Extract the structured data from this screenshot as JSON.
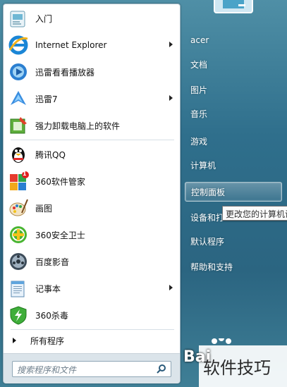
{
  "left_panel": {
    "items": [
      {
        "label": "入门",
        "icon": "getting-started-icon",
        "submenu": false
      },
      {
        "label": "Internet Explorer",
        "icon": "internet-explorer-icon",
        "submenu": true
      },
      {
        "label": "迅雷看看播放器",
        "icon": "xunlei-kankan-player-icon",
        "submenu": false
      },
      {
        "label": "迅雷7",
        "icon": "xunlei7-icon",
        "submenu": true
      },
      {
        "label": "强力卸载电脑上的软件",
        "icon": "uninstaller-icon",
        "submenu": false
      },
      {
        "label": "腾讯QQ",
        "icon": "qq-penguin-icon",
        "submenu": false
      },
      {
        "label": "360软件管家",
        "icon": "360-software-manager-icon",
        "submenu": false
      },
      {
        "label": "画图",
        "icon": "paint-palette-icon",
        "submenu": false
      },
      {
        "label": "360安全卫士",
        "icon": "360-security-guard-icon",
        "submenu": false
      },
      {
        "label": "百度影音",
        "icon": "baidu-player-icon",
        "submenu": false
      },
      {
        "label": "记事本",
        "icon": "notepad-icon",
        "submenu": true
      },
      {
        "label": "360杀毒",
        "icon": "360-antivirus-icon",
        "submenu": false
      }
    ],
    "all_programs": "所有程序",
    "search_placeholder": "搜索程序和文件",
    "badge_360": "1"
  },
  "right_panel": {
    "items": [
      {
        "label": "acer"
      },
      {
        "label": "文档"
      },
      {
        "label": "图片"
      },
      {
        "label": "音乐"
      },
      {
        "label": "游戏"
      },
      {
        "label": "计算机"
      },
      {
        "label": "控制面板",
        "highlighted": true
      },
      {
        "label": "设备和打"
      },
      {
        "label": "默认程序"
      },
      {
        "label": "帮助和支持"
      }
    ]
  },
  "tooltip": {
    "text": "更改您的计算机设"
  },
  "watermark": {
    "logo": "Bai",
    "text": "软件技巧"
  },
  "colors": {
    "menu_bg": "#2f6f8c",
    "highlight_border": "#ffffff",
    "tooltip_bg": "#fbfbfb"
  }
}
